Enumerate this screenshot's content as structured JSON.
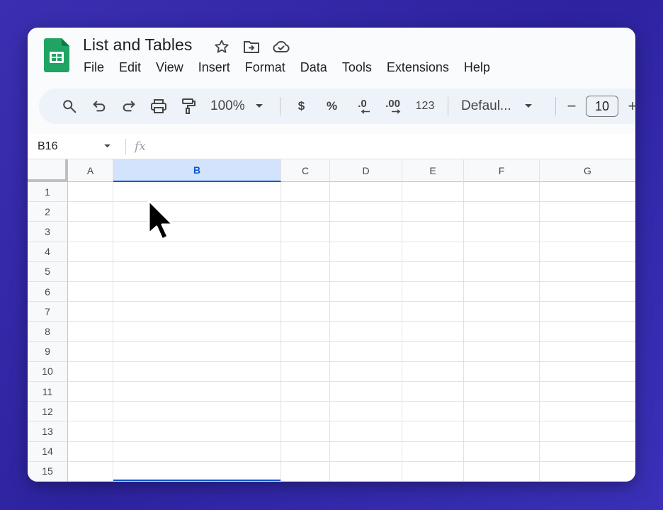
{
  "title": "List and Tables",
  "menu": [
    "File",
    "Edit",
    "View",
    "Insert",
    "Format",
    "Data",
    "Tools",
    "Extensions",
    "Help"
  ],
  "toolbar": {
    "zoom": "100%",
    "currency": "$",
    "percent": "%",
    "decrease_decimal": ".0",
    "increase_decimal": ".00",
    "number_format": "123",
    "font": "Defaul...",
    "font_size": "10",
    "minus": "−",
    "plus": "+"
  },
  "formula_bar": {
    "cell_ref": "B16",
    "fx": "fx"
  },
  "columns": [
    "A",
    "B",
    "C",
    "D",
    "E",
    "F",
    "G"
  ],
  "selected_column": "B",
  "rows": [
    "1",
    "2",
    "3",
    "4",
    "5",
    "6",
    "7",
    "8",
    "9",
    "10",
    "11",
    "12",
    "13",
    "14",
    "15"
  ],
  "colors": {
    "accent": "#0b57d0",
    "selected_header": "#d3e3fd",
    "sheets_green": "#0f9d58"
  }
}
